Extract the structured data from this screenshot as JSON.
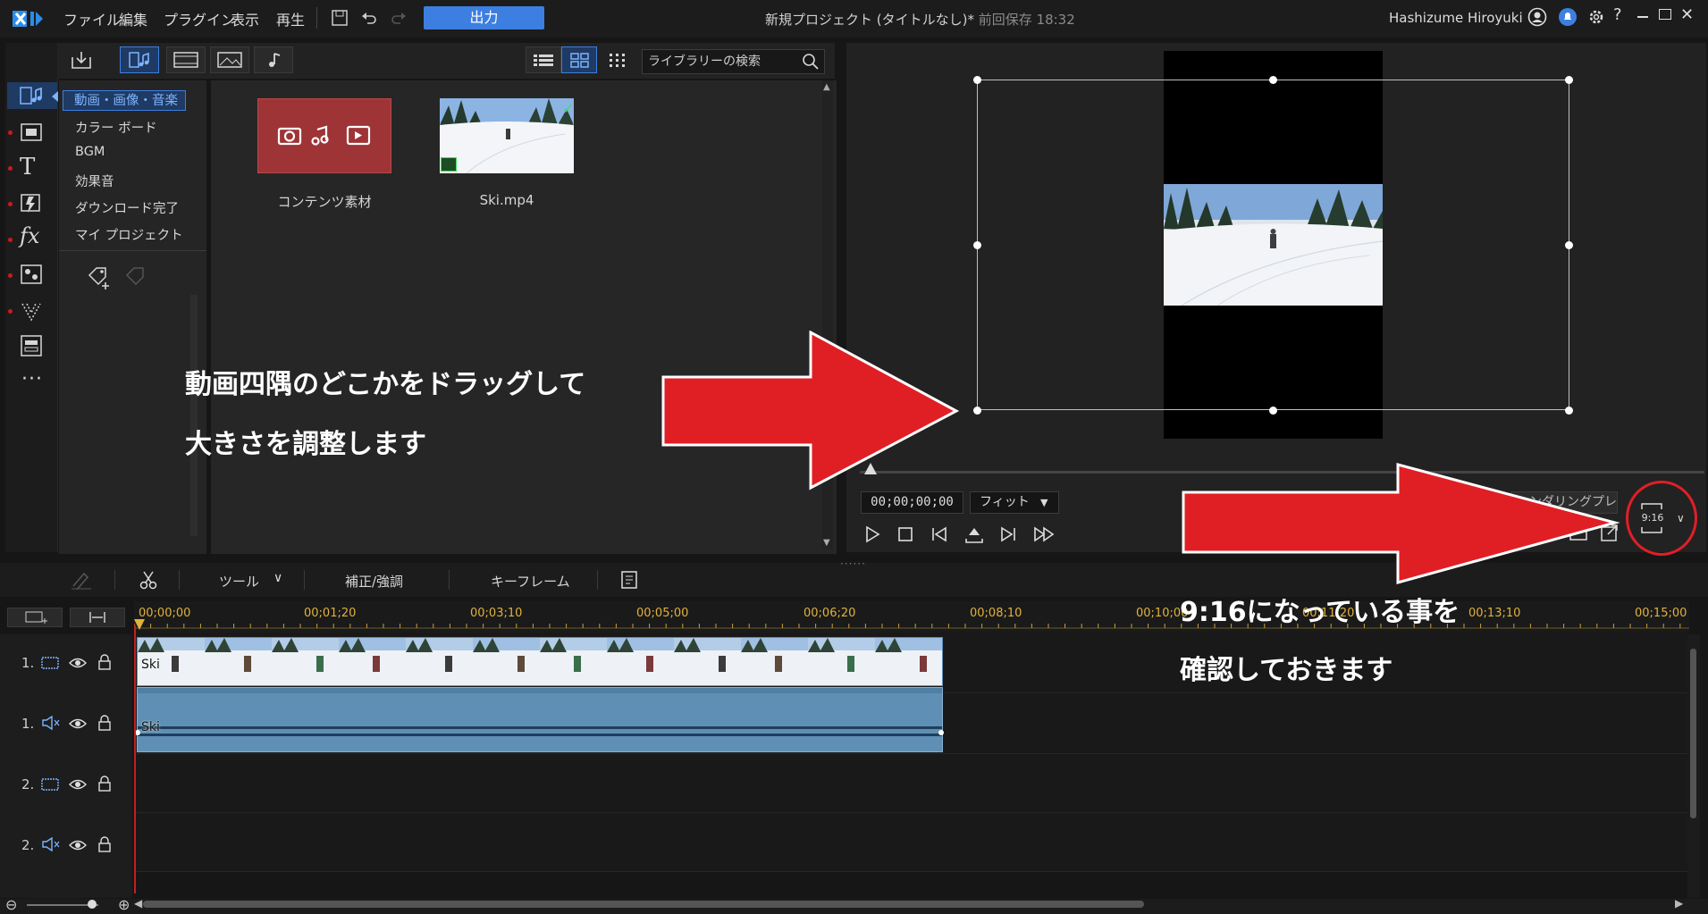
{
  "menu": [
    "ファイル",
    "編集",
    "プラグイン",
    "表示",
    "再生"
  ],
  "toolbar": {
    "output_label": "出力"
  },
  "project": {
    "title": "新規プロジェクト (タイトルなし)*",
    "saved": "前回保存 18:32"
  },
  "user": {
    "name": "Hashizume Hiroyuki"
  },
  "library": {
    "search_placeholder": "ライブラリーの検索",
    "categories": [
      "動画・画像・音楽",
      "カラー ボード",
      "BGM",
      "効果音",
      "ダウンロード完了",
      "マイ プロジェクト"
    ],
    "items": [
      {
        "label": "コンテンツ素材"
      },
      {
        "label": "Ski.mp4"
      }
    ]
  },
  "preview": {
    "timecode": "00;00;00;00",
    "fit_label": "フィット",
    "render_preview_label": "レンダリングプレビ...",
    "aspect_ratio": "9:16"
  },
  "midbar": {
    "tools_label": "ツール",
    "correction_label": "補正/強調",
    "keyframe_label": "キーフレーム"
  },
  "timeline": {
    "ticks": [
      "00;00;00",
      "00;01;20",
      "00;03;10",
      "00;05;00",
      "00;06;20",
      "00;08;10",
      "00;10;00",
      "00;11;20",
      "00;13;10",
      "00;15;00"
    ],
    "tracks": [
      "1.",
      "1.",
      "2.",
      "2."
    ],
    "clip_name": "Ski"
  },
  "annotations": {
    "left_line1": "動画四隅のどこかをドラッグして",
    "left_line2": "大きさを調整します",
    "right_line1": "9:16になっている事を",
    "right_line2": "確認しておきます"
  },
  "colors": {
    "accent": "#3d7fe0",
    "arrow": "#e01f25",
    "tick": "#e0b23c"
  }
}
